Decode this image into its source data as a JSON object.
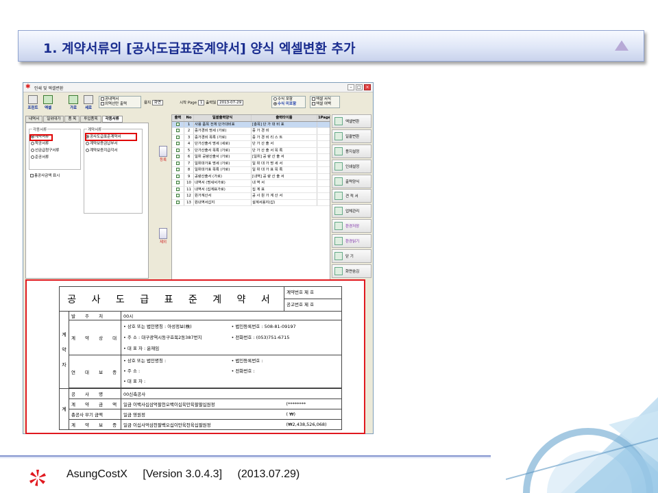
{
  "banner": {
    "title": "1. 계약서류의 [공사도급표준계약서] 양식 엑셀변환 추가"
  },
  "window": {
    "title": "인쇄 및 엑셀변환",
    "toolbar": {
      "print": "프린트",
      "excel": "엑셀",
      "landscape": "가로",
      "portrait": "세로",
      "opt1": "공내역서",
      "opt2": "외역선만 출력",
      "paper_label": "용지",
      "paper_value": "화면",
      "start_page_label": "시작 Page",
      "start_page_value": "1",
      "print_date_label": "출력일",
      "print_date_value": "2013-07-29",
      "r1": "수식 포함",
      "r2": "수식 미포함",
      "c1": "엑셀 서식",
      "c2": "엑셀 여백"
    },
    "tabs": [
      "내역서",
      "일위대가",
      "품 목",
      "투입품목",
      "각종서류"
    ],
    "left": {
      "group1_title": "각종서류",
      "group1": [
        "계약서류",
        "착공서류",
        "선금급청구서류",
        "준공서류"
      ],
      "group2_title": "계약서류",
      "group2": [
        "공사도급표준계약서",
        "계약보증금납부서",
        "계약보증지급각서"
      ],
      "check": "총공사금액 표시"
    },
    "side_buttons": {
      "add": "등록",
      "remove": "제외"
    },
    "grid": {
      "headers": [
        "출력",
        "No",
        "일괄출력양식",
        "출력타이틀",
        "1Page"
      ],
      "rows": [
        {
          "no": "1",
          "form": "사용 품목 전체 단가대비표",
          "title": "[총목] 단 가 대 비 표"
        },
        {
          "no": "2",
          "form": "중가경비 명세 (가로)",
          "title": "중 가 경 비"
        },
        {
          "no": "3",
          "form": "중가경비 목록 (가로)",
          "title": "중 가 경 비 리 스 트"
        },
        {
          "no": "4",
          "form": "단가산출서 명세 (세로)",
          "title": "단 가 산 출 서"
        },
        {
          "no": "5",
          "form": "단가산출서 목록 (가로)",
          "title": "단 가 산 출 서 목 록"
        },
        {
          "no": "6",
          "form": "일위 공량산출서 (가로)",
          "title": "[일위] 공 량 산 출 서"
        },
        {
          "no": "7",
          "form": "일위대가표 명세 (가로)",
          "title": "일 위 대 가 명 세 서"
        },
        {
          "no": "8",
          "form": "일위대가표 목록 (가로)",
          "title": "일 위 대 가 표 목 록"
        },
        {
          "no": "9",
          "form": "공량산출서 (가로)",
          "title": "[내역] 공 량 산 출 서"
        },
        {
          "no": "10",
          "form": "내역서 (명세서가로)",
          "title": "내 역 서"
        },
        {
          "no": "11",
          "form": "내역서 (집계표가로)",
          "title": "집 계 표"
        },
        {
          "no": "12",
          "form": "원가계산서",
          "title": "공 사 원 가 계 산 서"
        },
        {
          "no": "13",
          "form": "원내역서갑지",
          "title": "설계서용지(갑)"
        }
      ]
    },
    "right_buttons": [
      "엑셀변환",
      "일괄변환",
      "용지설정",
      "인쇄설정",
      "출력양식",
      "견 적 서",
      "업체관리",
      "환경저장",
      "환경읽기",
      "닫 기",
      "화면숨김"
    ]
  },
  "document": {
    "title": "공 사 도 급 표 준 계 약 서",
    "contract_no": "계약번호 제          호",
    "guarantee_no": "공고번호 제          호",
    "side_a": [
      "계",
      "약",
      "자"
    ],
    "orderer_label": "발 주 처",
    "orderer_value": "00시",
    "contractor_label": "계 약 상 대 자",
    "c_company": "• 상호 또는 법인명칭 : 아성정보(株)",
    "c_address": "• 주          소 : 대구광역시동구효목2동387번지",
    "c_ceo": "• 대 표 자 : 윤재임",
    "c_regno": "• 법인등록번호 : 508-81-09197",
    "c_phone": "• 전화번호 : (053)751-6715",
    "guarantor_label": "연 대 보 증 인",
    "g_company": "• 상호 또는 법인명칭 :",
    "g_address": "• 주          소 :",
    "g_ceo": "• 대 표 자 :",
    "g_regno": "• 법인등록번호 :",
    "g_phone": "• 전화번호 :",
    "side_b": "계",
    "project_label": "공 사 명",
    "project_value": "00신축공사",
    "amount_label": "계 약 금 액",
    "amount_value": "일금 이백사십삼억팔천오백이십육만육팔팔십원정",
    "amount_num": "(********",
    "vat_label": "총공사 부기 금액",
    "vat_value": "일금 영원정",
    "vat_num": "(                   ₩)",
    "deposit_label": "계 약 보 증 금",
    "deposit_value": "일금 이십사억삼천팔백오십이만육천육십팔원정",
    "deposit_num": "(₩2,438,526,068)"
  },
  "footer": {
    "product": "AsungCostX",
    "version": "[Version 3.0.4.3]",
    "date": "(2013.07.29)"
  },
  "colors": {
    "banner_text": "#1a2d8f",
    "highlight": "#e00000",
    "footer_line": "#7b8dcc"
  }
}
